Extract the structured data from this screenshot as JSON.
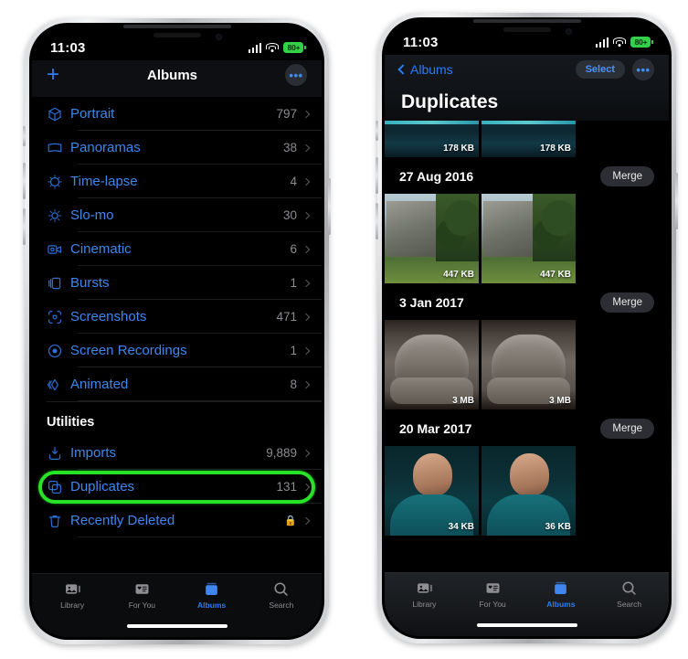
{
  "status_bar": {
    "time": "11:03",
    "battery_label": "80+",
    "signal_icon": "cellular-signal-icon",
    "wifi_icon": "wifi-icon",
    "battery_icon": "battery-icon"
  },
  "colors": {
    "accent_blue": "#3f87ef",
    "highlight_green": "#27e327",
    "battery_green": "#35d04a",
    "screen_black": "#000000"
  },
  "left_phone": {
    "nav": {
      "add_label": "+",
      "title": "Albums",
      "more_label": "•••"
    },
    "albums": [
      {
        "icon": "portrait-cube-icon",
        "label": "Portrait",
        "count": "797"
      },
      {
        "icon": "panorama-icon",
        "label": "Panoramas",
        "count": "38"
      },
      {
        "icon": "time-lapse-icon",
        "label": "Time-lapse",
        "count": "4"
      },
      {
        "icon": "slo-mo-icon",
        "label": "Slo-mo",
        "count": "30"
      },
      {
        "icon": "cinematic-video-icon",
        "label": "Cinematic",
        "count": "6"
      },
      {
        "icon": "bursts-icon",
        "label": "Bursts",
        "count": "1"
      },
      {
        "icon": "screenshots-icon",
        "label": "Screenshots",
        "count": "471"
      },
      {
        "icon": "screen-recordings-icon",
        "label": "Screen Recordings",
        "count": "1"
      },
      {
        "icon": "animated-icon",
        "label": "Animated",
        "count": "8"
      }
    ],
    "utilities_header": "Utilities",
    "utilities": [
      {
        "icon": "imports-icon",
        "label": "Imports",
        "count": "9,889",
        "locked": false,
        "highlighted": false
      },
      {
        "icon": "duplicates-icon",
        "label": "Duplicates",
        "count": "131",
        "locked": false,
        "highlighted": true
      },
      {
        "icon": "trash-icon",
        "label": "Recently Deleted",
        "count": "",
        "locked": true,
        "highlighted": false
      }
    ]
  },
  "right_phone": {
    "nav": {
      "back_label": "Albums",
      "select_label": "Select",
      "more_label": "•••"
    },
    "large_title": "Duplicates",
    "groups": [
      {
        "date": "",
        "merge_label": "",
        "partial": true,
        "art": "art-city",
        "photos": [
          {
            "size": "178 KB"
          },
          {
            "size": "178 KB"
          }
        ]
      },
      {
        "date": "27 Aug 2016",
        "merge_label": "Merge",
        "partial": false,
        "art": "art-building",
        "photos": [
          {
            "size": "447 KB"
          },
          {
            "size": "447 KB"
          }
        ]
      },
      {
        "date": "3 Jan 2017",
        "merge_label": "Merge",
        "partial": false,
        "art": "art-chair",
        "photos": [
          {
            "size": "3 MB"
          },
          {
            "size": "3 MB"
          }
        ]
      },
      {
        "date": "20 Mar 2017",
        "merge_label": "Merge",
        "partial": false,
        "art": "art-man",
        "photos": [
          {
            "size": "34 KB"
          },
          {
            "size": "36 KB"
          }
        ]
      }
    ]
  },
  "tab_bar": {
    "tabs": [
      {
        "icon": "library-icon",
        "label": "Library",
        "active": false
      },
      {
        "icon": "for-you-icon",
        "label": "For You",
        "active": false
      },
      {
        "icon": "albums-icon",
        "label": "Albums",
        "active": true
      },
      {
        "icon": "search-icon",
        "label": "Search",
        "active": false
      }
    ]
  }
}
